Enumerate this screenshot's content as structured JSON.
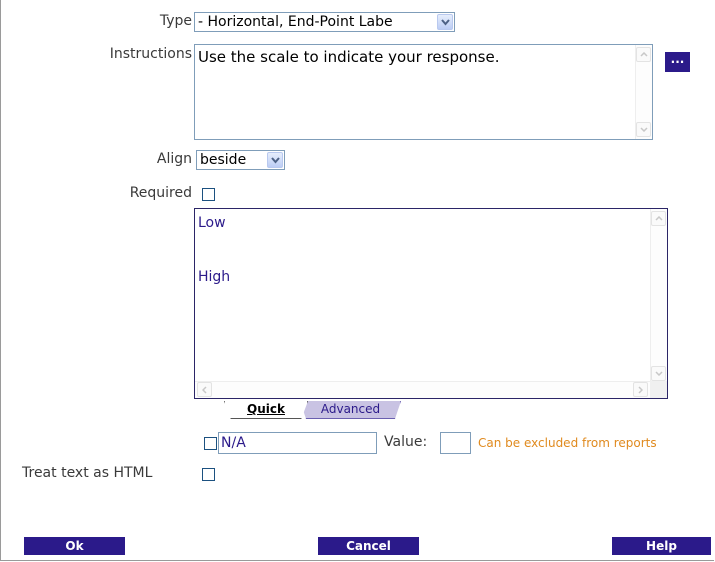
{
  "form": {
    "type": {
      "label": "Type",
      "value": "- Horizontal, End-Point Labe"
    },
    "instructions": {
      "label": "Instructions",
      "value": "Use the scale to indicate your response.",
      "more_button": "..."
    },
    "align": {
      "label": "Align",
      "value": "beside"
    },
    "required": {
      "label": "Required",
      "checked": false
    },
    "scale_labels": [
      "Low",
      "High"
    ],
    "tabs": {
      "quick": "Quick",
      "advanced": "Advanced",
      "active": "Quick"
    },
    "na_option": {
      "checked": false,
      "text": "N/A",
      "value_label": "Value:",
      "value": "",
      "note": "Can be excluded from reports"
    },
    "html": {
      "label": "Treat text as HTML",
      "checked": false
    }
  },
  "buttons": {
    "ok": "Ok",
    "cancel": "Cancel",
    "help": "Help"
  },
  "colors": {
    "accent": "#2b1a8a",
    "note": "#e08a1e",
    "border": "#7f9db9"
  }
}
